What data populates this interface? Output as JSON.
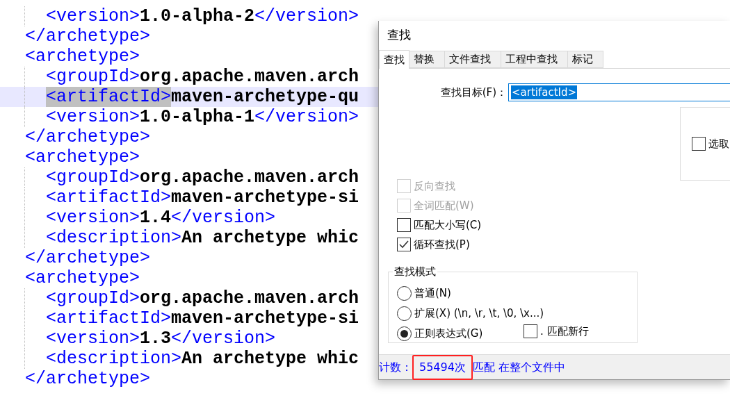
{
  "editor": {
    "lines": [
      {
        "indented": true,
        "current": false,
        "segments": [
          {
            "kind": "tag",
            "text": "<version>"
          },
          {
            "kind": "text",
            "text": "1.0-alpha-2"
          },
          {
            "kind": "tag",
            "text": "</version>"
          }
        ]
      },
      {
        "indented": false,
        "current": false,
        "segments": [
          {
            "kind": "tag",
            "text": "</archetype>"
          }
        ]
      },
      {
        "indented": false,
        "current": false,
        "segments": [
          {
            "kind": "tag",
            "text": "<archetype>"
          }
        ]
      },
      {
        "indented": true,
        "current": false,
        "segments": [
          {
            "kind": "tag",
            "text": "<groupId>"
          },
          {
            "kind": "text",
            "text": "org.apache.maven.arch"
          }
        ]
      },
      {
        "indented": true,
        "current": true,
        "segments": [
          {
            "kind": "tag",
            "text": "<artifactId>",
            "match": true
          },
          {
            "kind": "text",
            "text": "maven-archetype-qu"
          }
        ]
      },
      {
        "indented": true,
        "current": false,
        "segments": [
          {
            "kind": "tag",
            "text": "<version>"
          },
          {
            "kind": "text",
            "text": "1.0-alpha-1"
          },
          {
            "kind": "tag",
            "text": "</version>"
          }
        ]
      },
      {
        "indented": false,
        "current": false,
        "segments": [
          {
            "kind": "tag",
            "text": "</archetype>"
          }
        ]
      },
      {
        "indented": false,
        "current": false,
        "segments": [
          {
            "kind": "tag",
            "text": "<archetype>"
          }
        ]
      },
      {
        "indented": true,
        "current": false,
        "segments": [
          {
            "kind": "tag",
            "text": "<groupId>"
          },
          {
            "kind": "text",
            "text": "org.apache.maven.arch"
          }
        ]
      },
      {
        "indented": true,
        "current": false,
        "segments": [
          {
            "kind": "tag",
            "text": "<artifactId>"
          },
          {
            "kind": "text",
            "text": "maven-archetype-si"
          }
        ]
      },
      {
        "indented": true,
        "current": false,
        "segments": [
          {
            "kind": "tag",
            "text": "<version>"
          },
          {
            "kind": "text",
            "text": "1.4"
          },
          {
            "kind": "tag",
            "text": "</version>"
          }
        ]
      },
      {
        "indented": true,
        "current": false,
        "segments": [
          {
            "kind": "tag",
            "text": "<description>"
          },
          {
            "kind": "text",
            "text": "An archetype whic"
          }
        ]
      },
      {
        "indented": false,
        "current": false,
        "segments": [
          {
            "kind": "tag",
            "text": "</archetype>"
          }
        ]
      },
      {
        "indented": false,
        "current": false,
        "segments": [
          {
            "kind": "tag",
            "text": "<archetype>"
          }
        ]
      },
      {
        "indented": true,
        "current": false,
        "segments": [
          {
            "kind": "tag",
            "text": "<groupId>"
          },
          {
            "kind": "text",
            "text": "org.apache.maven.arch"
          }
        ]
      },
      {
        "indented": true,
        "current": false,
        "segments": [
          {
            "kind": "tag",
            "text": "<artifactId>"
          },
          {
            "kind": "text",
            "text": "maven-archetype-si"
          }
        ]
      },
      {
        "indented": true,
        "current": false,
        "segments": [
          {
            "kind": "tag",
            "text": "<version>"
          },
          {
            "kind": "text",
            "text": "1.3"
          },
          {
            "kind": "tag",
            "text": "</version>"
          }
        ]
      },
      {
        "indented": true,
        "current": false,
        "segments": [
          {
            "kind": "tag",
            "text": "<description>"
          },
          {
            "kind": "text",
            "text": "An archetype whic"
          }
        ]
      },
      {
        "indented": false,
        "current": false,
        "segments": [
          {
            "kind": "tag",
            "text": "</archetype>"
          }
        ]
      }
    ]
  },
  "dialog": {
    "title": "查找",
    "tabs": [
      {
        "label": "查找",
        "selected": true
      },
      {
        "label": "替换",
        "selected": false
      },
      {
        "label": "文件查找",
        "selected": false
      },
      {
        "label": "工程中查找",
        "selected": false
      },
      {
        "label": "标记",
        "selected": false
      }
    ],
    "find_target": {
      "label": "查找目标(F)：",
      "value": "<artifactId>"
    },
    "in_selection": {
      "label": "选取",
      "checked": false
    },
    "options": [
      {
        "label": "反向查找",
        "checked": false,
        "disabled": true
      },
      {
        "label": "全词匹配(W)",
        "checked": false,
        "disabled": true
      },
      {
        "label": "匹配大小写(C)",
        "checked": false,
        "disabled": false
      },
      {
        "label": "循环查找(P)",
        "checked": true,
        "disabled": false
      }
    ],
    "search_mode": {
      "title": "查找模式",
      "modes": [
        {
          "label": "普通(N)",
          "selected": false
        },
        {
          "label": "扩展(X) (\\n, \\r, \\t, \\0, \\x...)",
          "selected": false
        },
        {
          "label": "正则表达式(G)",
          "selected": true
        }
      ]
    },
    "dot_newline": {
      "label": ". 匹配新行",
      "checked": false
    },
    "status": {
      "label": "计数：",
      "count": "55494次",
      "rest": "匹配 在整个文件中",
      "highlighted": true
    }
  }
}
